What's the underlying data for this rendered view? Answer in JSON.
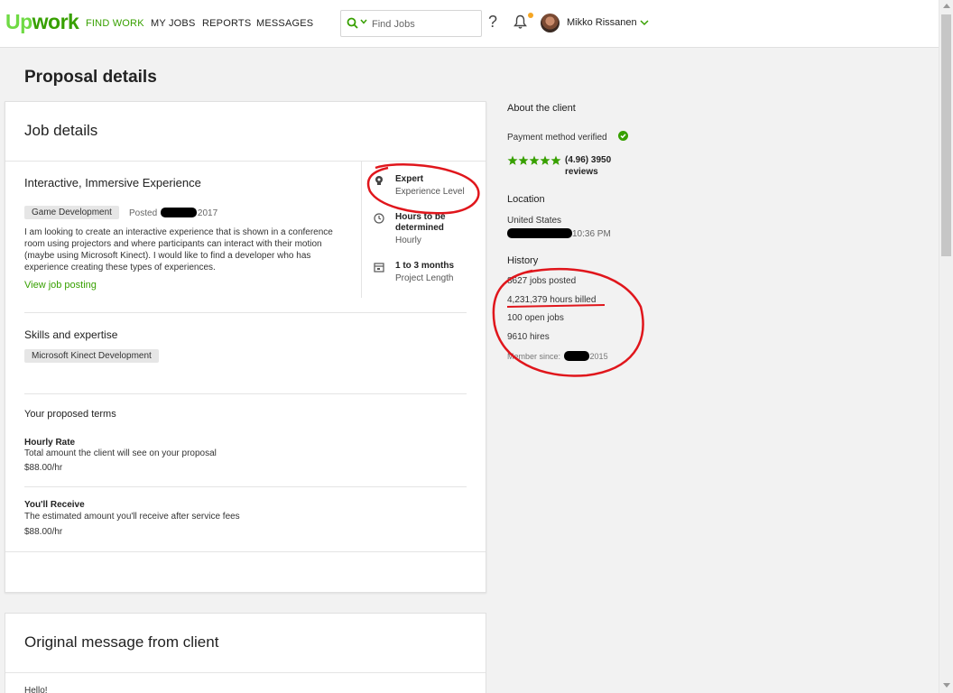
{
  "header": {
    "logo_up": "Up",
    "logo_rest": "work",
    "nav": [
      "FIND WORK",
      "MY JOBS",
      "REPORTS",
      "MESSAGES"
    ],
    "search_placeholder": "Find Jobs",
    "help": "?",
    "user_name": "Mikko Rissanen"
  },
  "page_title": "Proposal details",
  "job_details": {
    "heading": "Job details",
    "title": "Interactive, Immersive Experience",
    "category": "Game Development",
    "posted_label": "Posted",
    "posted_year": "2017",
    "description": "I am looking to create an interactive experience that is shown in a conference room using projectors and where participants can interact with their motion (maybe using Microsoft Kinect). I would like to find a developer who has experience creating these types of experiences.",
    "view_link": "View job posting",
    "experience": {
      "main": "Expert",
      "sub": "Experience Level"
    },
    "hours": {
      "main": "Hours to be determined",
      "sub": "Hourly"
    },
    "length": {
      "main": "1 to 3 months",
      "sub": "Project Length"
    }
  },
  "skills": {
    "heading": "Skills and expertise",
    "items": [
      "Microsoft Kinect Development"
    ]
  },
  "terms": {
    "heading": "Your proposed terms",
    "rate_title": "Hourly Rate",
    "rate_desc": "Total amount the client will see on your proposal",
    "rate_value": "$88.00/hr",
    "receive_title": "You'll Receive",
    "receive_desc": "The estimated amount you'll receive after service fees",
    "receive_value": "$88.00/hr"
  },
  "original_message": {
    "heading": "Original message from client",
    "greeting": "Hello!"
  },
  "client": {
    "heading": "About the client",
    "payment": "Payment method verified",
    "rating": "(4.96) 3950",
    "reviews": "reviews",
    "star_count": 5,
    "location_heading": "Location",
    "country": "United States",
    "local_time": "10:36 PM",
    "history_heading": "History",
    "jobs_posted": "8627 jobs posted",
    "hours_billed": "4,231,379 hours billed",
    "open_jobs": "100 open jobs",
    "hires": "9610 hires",
    "member_label": "Member since:",
    "member_year": "2015"
  },
  "colors": {
    "brand_green": "#6fda44",
    "link_green": "#37a000",
    "annotation_red": "#e0161c"
  }
}
